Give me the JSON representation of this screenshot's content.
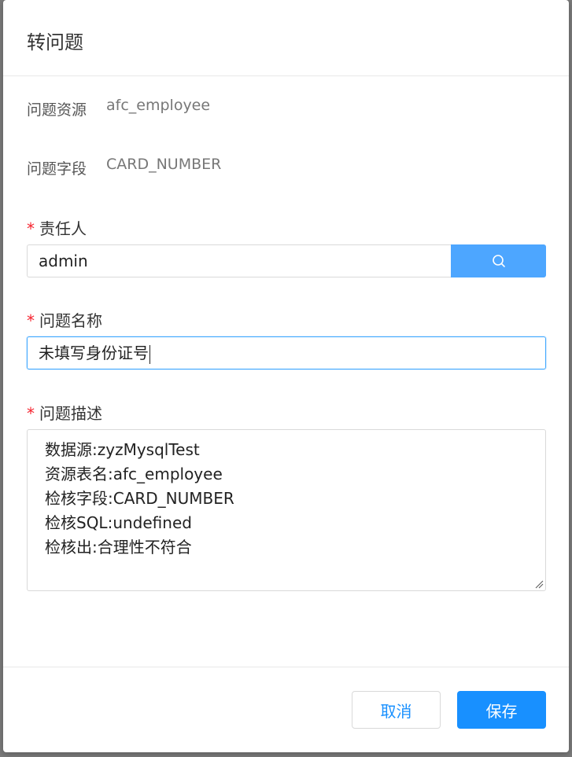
{
  "dialog": {
    "title": "转问题"
  },
  "form": {
    "resource": {
      "label": "问题资源",
      "value": "afc_employee"
    },
    "field": {
      "label": "问题字段",
      "value": "CARD_NUMBER"
    },
    "owner": {
      "required_mark": "*",
      "label": "责任人",
      "value": "admin",
      "search_icon": "search-icon"
    },
    "issue_name": {
      "required_mark": "*",
      "label": "问题名称",
      "value": "未填写身份证号"
    },
    "issue_description": {
      "required_mark": "*",
      "label": "问题描述",
      "lines": [
        "数据源:zyzMysqlTest",
        "资源表名:afc_employee",
        "检核字段:CARD_NUMBER",
        "检核SQL:undefined",
        "检核出:合理性不符合"
      ]
    }
  },
  "footer": {
    "cancel_label": "取消",
    "save_label": "保存"
  },
  "colors": {
    "primary": "#1890ff",
    "search_button": "#4da6ff",
    "required": "#f5222d"
  }
}
